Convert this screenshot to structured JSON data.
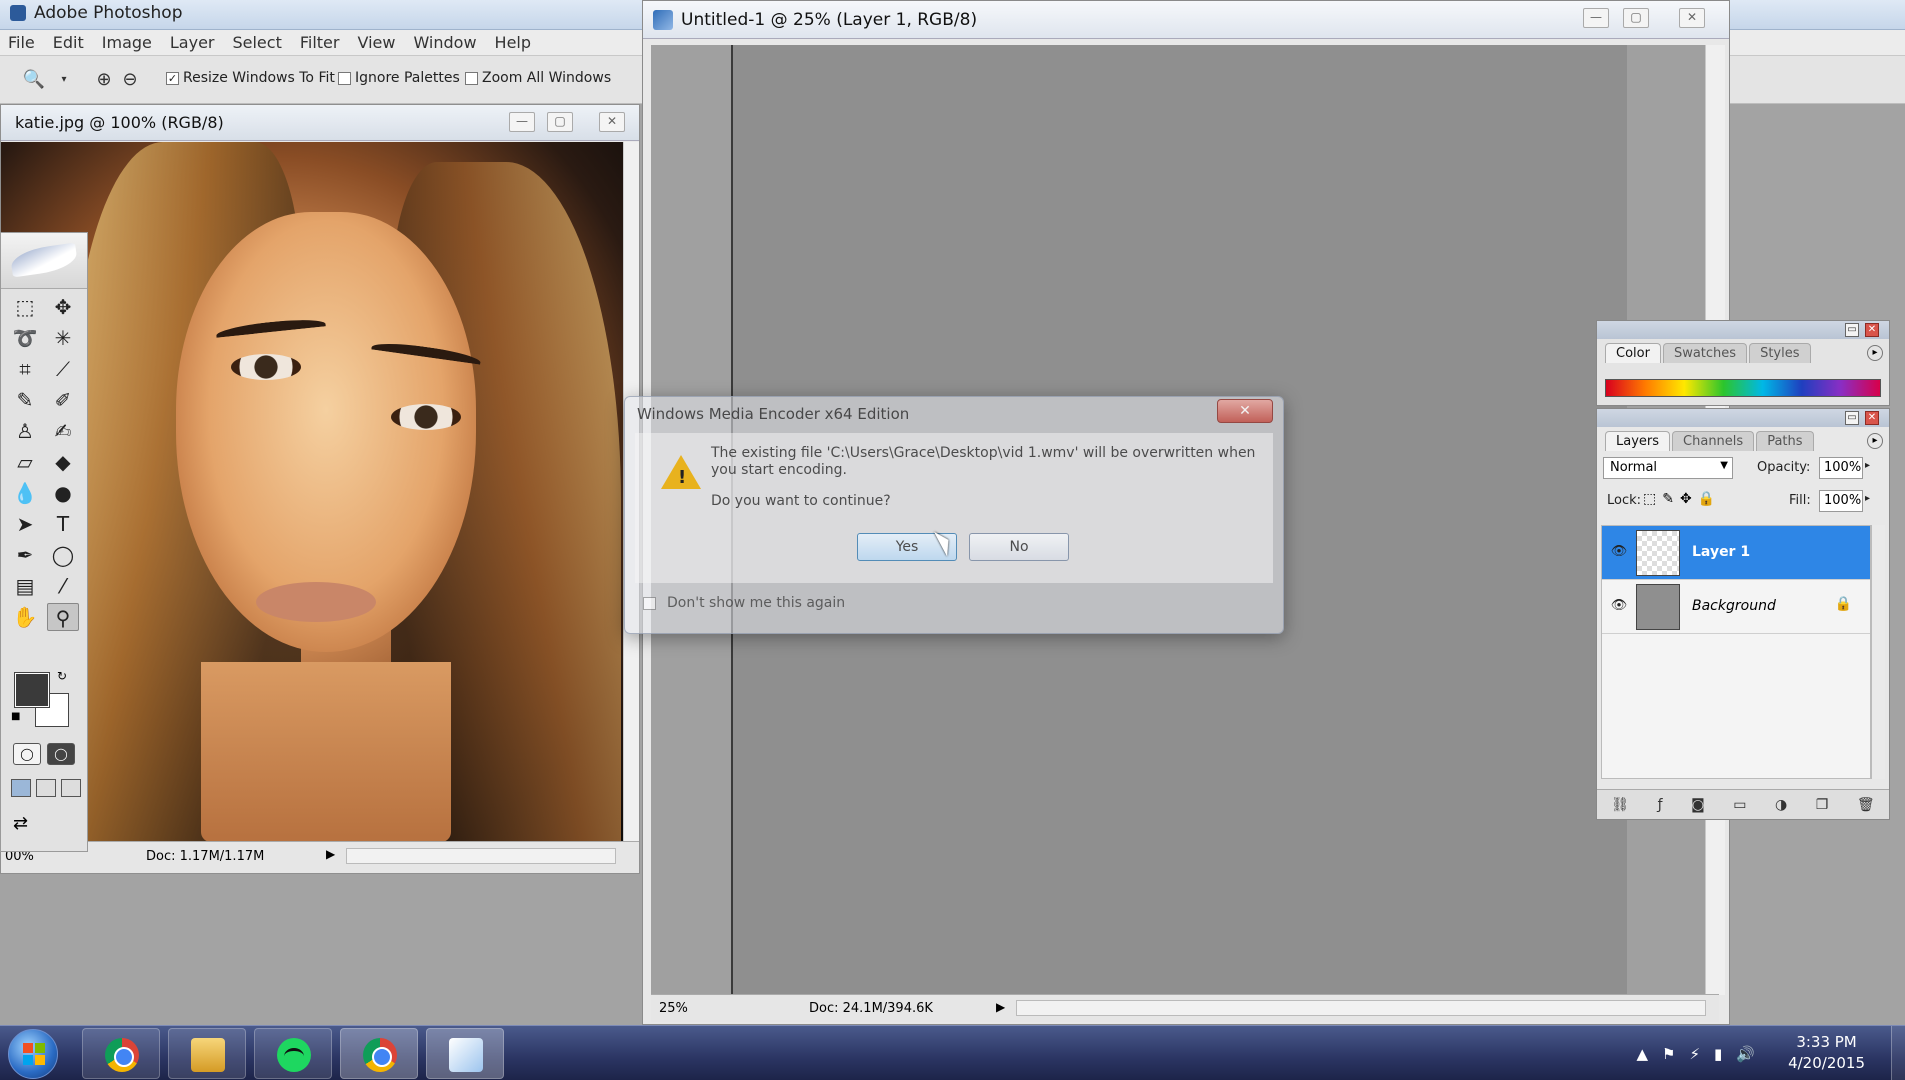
{
  "photoshop": {
    "title": "Adobe Photoshop",
    "menus": [
      "File",
      "Edit",
      "Image",
      "Layer",
      "Select",
      "Filter",
      "View",
      "Window",
      "Help"
    ],
    "options": {
      "resize_windows": "Resize Windows To Fit",
      "ignore_palettes": "Ignore Palettes",
      "zoom_all": "Zoom All Windows"
    }
  },
  "doc_katie": {
    "title": "katie.jpg @ 100% (RGB/8)",
    "zoom": "00%",
    "doc_info": "Doc: 1.17M/1.17M"
  },
  "doc_untitled": {
    "title": "Untitled-1 @ 25% (Layer 1, RGB/8)",
    "zoom": "25%",
    "doc_info": "Doc: 24.1M/394.6K"
  },
  "dialog": {
    "title": "Windows Media Encoder x64 Edition",
    "message": "The existing file 'C:\\Users\\Grace\\Desktop\\vid 1.wmv' will be overwritten when you start encoding.",
    "question": "Do you want to continue?",
    "yes": "Yes",
    "no": "No",
    "dont_show": "Don't show me this again",
    "close": "✕"
  },
  "color_palette": {
    "tabs": [
      "Color",
      "Swatches",
      "Styles"
    ]
  },
  "layers_palette": {
    "tabs": [
      "Layers",
      "Channels",
      "Paths"
    ],
    "blend_mode": "Normal",
    "opacity_label": "Opacity:",
    "opacity": "100%",
    "lock_label": "Lock:",
    "fill_label": "Fill:",
    "fill": "100%",
    "layers": [
      {
        "name": "Layer 1",
        "selected": true
      },
      {
        "name": "Background",
        "selected": false,
        "locked": true
      }
    ]
  },
  "taskbar": {
    "time": "3:33 PM",
    "date": "4/20/2015",
    "apps": [
      "chrome-icon",
      "explorer-icon",
      "spotify-icon",
      "chrome-icon",
      "media-encoder-icon"
    ]
  }
}
